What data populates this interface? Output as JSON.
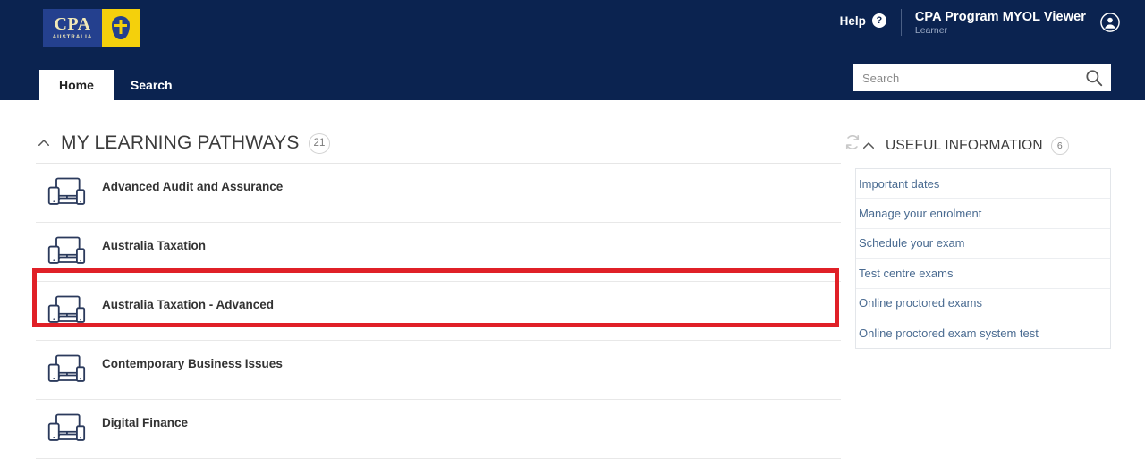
{
  "header": {
    "logo": {
      "brand": "CPA",
      "brand_sub": "AUSTRALIA",
      "crest_icon": "crest-icon"
    },
    "help_label": "Help",
    "help_icon": "question-mark-icon",
    "app_title": "CPA Program MYOL Viewer",
    "app_role": "Learner",
    "account_icon": "account-circle-icon",
    "nav_tabs": [
      {
        "label": "Home",
        "active": true
      },
      {
        "label": "Search",
        "active": false
      }
    ],
    "search": {
      "placeholder": "Search",
      "value": "",
      "icon": "search-icon"
    }
  },
  "main": {
    "learning_pathways": {
      "title": "MY LEARNING PATHWAYS",
      "count": "21",
      "collapse_icon": "chevron-up-icon",
      "refresh_icon": "refresh-icon",
      "items": [
        {
          "label": "Advanced Audit and Assurance",
          "icon": "multi-device-icon",
          "highlighted": true
        },
        {
          "label": "Australia Taxation",
          "icon": "multi-device-icon",
          "highlighted": false
        },
        {
          "label": "Australia Taxation - Advanced",
          "icon": "multi-device-icon",
          "highlighted": false
        },
        {
          "label": "Contemporary Business Issues",
          "icon": "multi-device-icon",
          "highlighted": false
        },
        {
          "label": "Digital Finance",
          "icon": "multi-device-icon",
          "highlighted": false
        }
      ]
    }
  },
  "sidebar": {
    "useful_information": {
      "title": "USEFUL INFORMATION",
      "count": "6",
      "collapse_icon": "chevron-up-icon",
      "links": [
        {
          "label": "Important dates"
        },
        {
          "label": "Manage your enrolment"
        },
        {
          "label": "Schedule your exam"
        },
        {
          "label": "Test centre exams"
        },
        {
          "label": "Online proctored exams"
        },
        {
          "label": "Online proctored exam system test"
        }
      ]
    }
  },
  "colors": {
    "header_navy": "#0b2350",
    "logo_blue": "#24408e",
    "logo_yellow": "#f4d00c",
    "highlight_red": "#e02027",
    "link_blue": "#4a6b91",
    "device_icon": "#2b3a5c"
  }
}
